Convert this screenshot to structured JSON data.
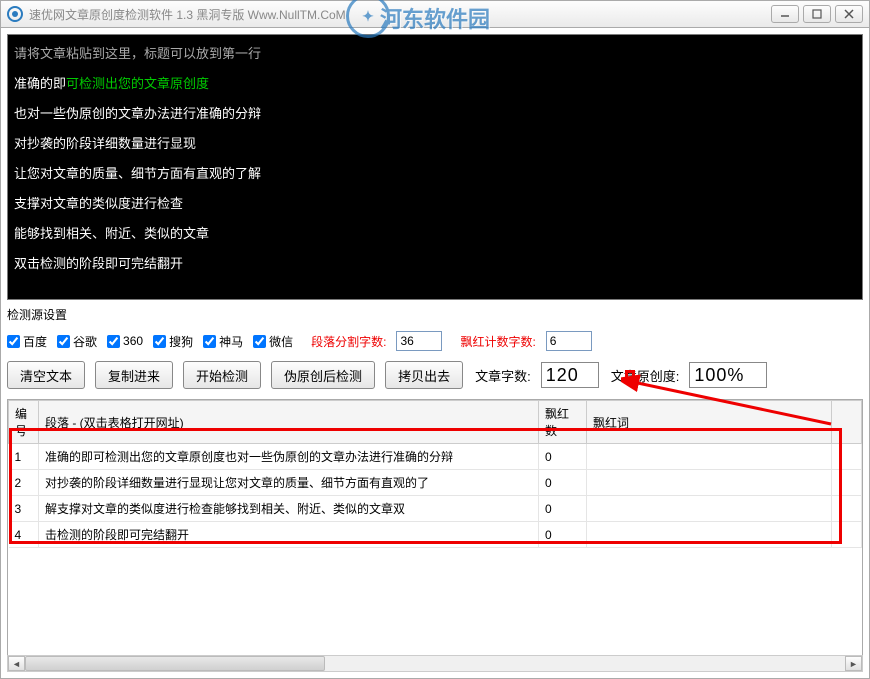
{
  "titlebar": {
    "title": "速优网文章原创度检测软件 1.3   黑洞专版 Www.NullTM.CoM"
  },
  "watermark": {
    "text": "河东软件园"
  },
  "editor": {
    "placeholder": "请将文章粘贴到这里，标题可以放到第一行",
    "line1_a": "准确的即",
    "line1_b": "可检测出您的文章原创度",
    "line2": "也对一些伪原创的文章办法进行准确的分辩",
    "line3": "对抄袭的阶段详细数量进行显现",
    "line4": "让您对文章的质量、细节方面有直观的了解",
    "line5": "支撑对文章的类似度进行检查",
    "line6": "能够找到相关、附近、类似的文章",
    "line7": "双击检测的阶段即可完结翻开"
  },
  "sources": {
    "label": "检测源设置",
    "items": [
      "百度",
      "谷歌",
      "360",
      "搜狗",
      "神马",
      "微信"
    ]
  },
  "params": {
    "split_label": "段落分割字数:",
    "split_value": "36",
    "red_label": "飘红计数字数:",
    "red_value": "6"
  },
  "buttons": {
    "clear": "清空文本",
    "paste": "复制进来",
    "start": "开始检测",
    "pseudo": "伪原创后检测",
    "copyout": "拷贝出去"
  },
  "stats": {
    "count_label": "文章字数:",
    "count_value": "120",
    "orig_label": "文章原创度:",
    "orig_value": "100%"
  },
  "table": {
    "headers": {
      "id": "编号",
      "segment": "段落 - (双击表格打开网址)",
      "redcount": "飘红数",
      "redwords": "飘红词"
    },
    "rows": [
      {
        "id": "1",
        "seg": "准确的即可检测出您的文章原创度也对一些伪原创的文章办法进行准确的分辩",
        "red": "0",
        "words": ""
      },
      {
        "id": "2",
        "seg": "对抄袭的阶段详细数量进行显现让您对文章的质量、细节方面有直观的了",
        "red": "0",
        "words": ""
      },
      {
        "id": "3",
        "seg": "解支撑对文章的类似度进行检查能够找到相关、附近、类似的文章双",
        "red": "0",
        "words": ""
      },
      {
        "id": "4",
        "seg": "击检测的阶段即可完结翻开",
        "red": "0",
        "words": ""
      }
    ]
  }
}
